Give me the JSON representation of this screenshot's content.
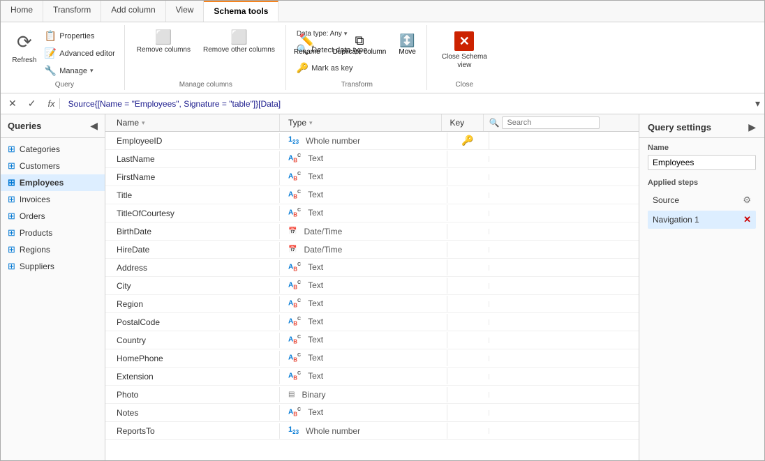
{
  "ribbon": {
    "tabs": [
      {
        "label": "Home",
        "active": false
      },
      {
        "label": "Transform",
        "active": false
      },
      {
        "label": "Add column",
        "active": false
      },
      {
        "label": "View",
        "active": false
      },
      {
        "label": "Schema tools",
        "active": true
      }
    ],
    "groups": {
      "query": {
        "label": "Query",
        "refresh_label": "Refresh",
        "properties_label": "Properties",
        "advanced_editor_label": "Advanced editor",
        "manage_label": "Manage"
      },
      "manage_columns": {
        "label": "Manage columns",
        "remove_columns_label": "Remove columns",
        "remove_other_label": "Remove other columns"
      },
      "transform": {
        "label": "Transform",
        "data_type_label": "Data type: Any",
        "detect_label": "Detect data type",
        "mark_label": "Mark as key",
        "rename_label": "Rename",
        "duplicate_label": "Duplicate column",
        "move_label": "Move"
      },
      "close": {
        "label": "Close",
        "close_schema_label": "Close Schema\nview"
      }
    }
  },
  "formula_bar": {
    "formula_text": "Source{[Name = \"Employees\", Signature = \"table\"]}[Data]"
  },
  "sidebar": {
    "title": "Queries",
    "items": [
      {
        "label": "Categories",
        "active": false
      },
      {
        "label": "Customers",
        "active": false
      },
      {
        "label": "Employees",
        "active": true
      },
      {
        "label": "Invoices",
        "active": false
      },
      {
        "label": "Orders",
        "active": false
      },
      {
        "label": "Products",
        "active": false
      },
      {
        "label": "Regions",
        "active": false
      },
      {
        "label": "Suppliers",
        "active": false
      }
    ]
  },
  "schema_table": {
    "col_name_label": "Name",
    "col_type_label": "Type",
    "col_key_label": "Key",
    "search_placeholder": "Search",
    "rows": [
      {
        "name": "EmployeeID",
        "type_icon": "123",
        "type_label": "Whole number",
        "key": true
      },
      {
        "name": "LastName",
        "type_icon": "ABC",
        "type_label": "Text",
        "key": false
      },
      {
        "name": "FirstName",
        "type_icon": "ABC",
        "type_label": "Text",
        "key": false
      },
      {
        "name": "Title",
        "type_icon": "ABC",
        "type_label": "Text",
        "key": false
      },
      {
        "name": "TitleOfCourtesy",
        "type_icon": "ABC",
        "type_label": "Text",
        "key": false
      },
      {
        "name": "BirthDate",
        "type_icon": "DT",
        "type_label": "Date/Time",
        "key": false
      },
      {
        "name": "HireDate",
        "type_icon": "DT",
        "type_label": "Date/Time",
        "key": false
      },
      {
        "name": "Address",
        "type_icon": "ABC",
        "type_label": "Text",
        "key": false
      },
      {
        "name": "City",
        "type_icon": "ABC",
        "type_label": "Text",
        "key": false
      },
      {
        "name": "Region",
        "type_icon": "ABC",
        "type_label": "Text",
        "key": false
      },
      {
        "name": "PostalCode",
        "type_icon": "ABC",
        "type_label": "Text",
        "key": false
      },
      {
        "name": "Country",
        "type_icon": "ABC",
        "type_label": "Text",
        "key": false
      },
      {
        "name": "HomePhone",
        "type_icon": "ABC",
        "type_label": "Text",
        "key": false
      },
      {
        "name": "Extension",
        "type_icon": "ABC",
        "type_label": "Text",
        "key": false
      },
      {
        "name": "Photo",
        "type_icon": "BIN",
        "type_label": "Binary",
        "key": false
      },
      {
        "name": "Notes",
        "type_icon": "ABC",
        "type_label": "Text",
        "key": false
      },
      {
        "name": "ReportsTo",
        "type_icon": "123",
        "type_label": "Whole number",
        "key": false
      }
    ]
  },
  "query_settings": {
    "title": "Query settings",
    "name_label": "Name",
    "name_value": "Employees",
    "applied_steps_label": "Applied steps",
    "steps": [
      {
        "label": "Source",
        "has_gear": true,
        "has_x": false
      },
      {
        "label": "Navigation 1",
        "has_gear": false,
        "has_x": true
      }
    ]
  }
}
